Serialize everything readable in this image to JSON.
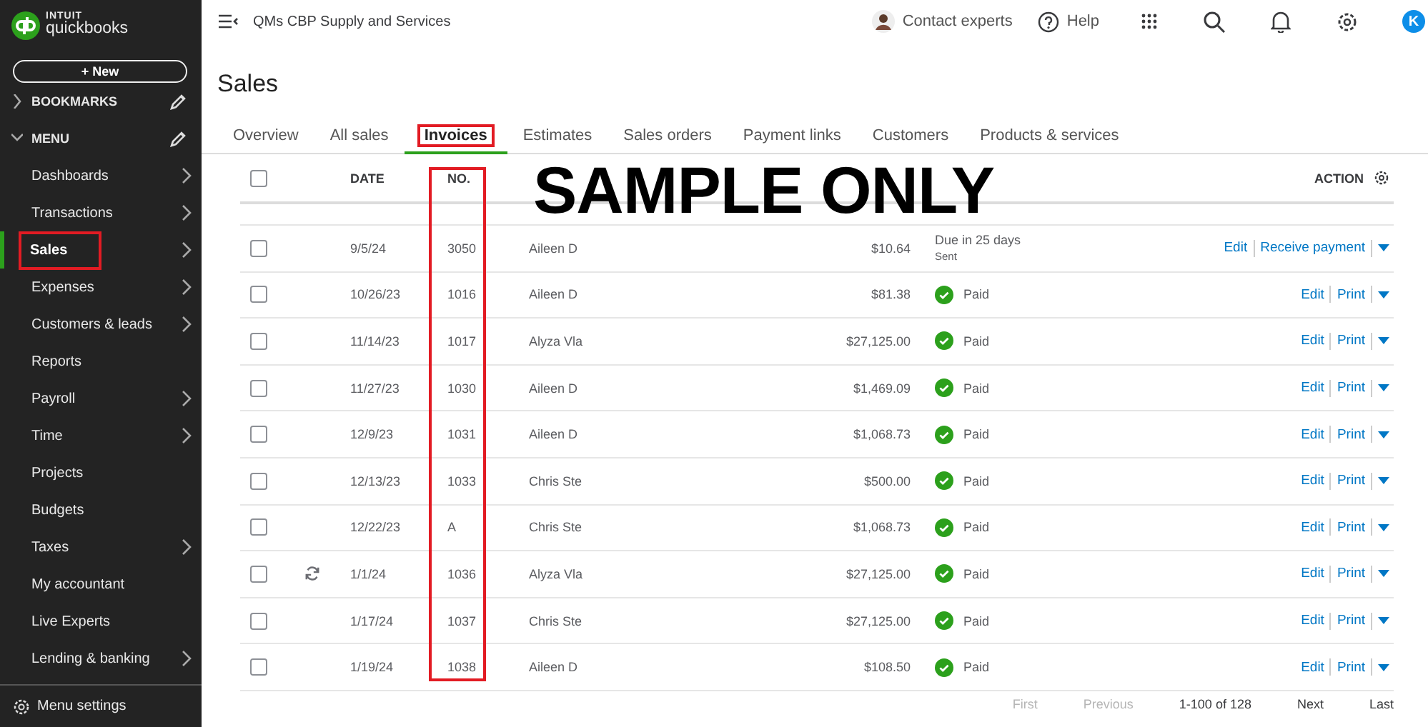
{
  "sidebar": {
    "logo": {
      "brand": "INTUIT",
      "product": "quickbooks"
    },
    "new_button": "+ New",
    "sections": [
      {
        "label": "BOOKMARKS",
        "expanded": false
      },
      {
        "label": "MENU",
        "expanded": true
      }
    ],
    "items": [
      {
        "label": "Dashboards",
        "chevron": true,
        "selected": false,
        "highlighted": false
      },
      {
        "label": "Transactions",
        "chevron": true,
        "selected": false,
        "highlighted": false
      },
      {
        "label": "Sales",
        "chevron": true,
        "selected": true,
        "highlighted": true
      },
      {
        "label": "Expenses",
        "chevron": true,
        "selected": false,
        "highlighted": false
      },
      {
        "label": "Customers & leads",
        "chevron": true,
        "selected": false,
        "highlighted": false
      },
      {
        "label": "Reports",
        "chevron": false,
        "selected": false,
        "highlighted": false
      },
      {
        "label": "Payroll",
        "chevron": true,
        "selected": false,
        "highlighted": false
      },
      {
        "label": "Time",
        "chevron": true,
        "selected": false,
        "highlighted": false
      },
      {
        "label": "Projects",
        "chevron": false,
        "selected": false,
        "highlighted": false
      },
      {
        "label": "Budgets",
        "chevron": false,
        "selected": false,
        "highlighted": false
      },
      {
        "label": "Taxes",
        "chevron": true,
        "selected": false,
        "highlighted": false
      },
      {
        "label": "My accountant",
        "chevron": false,
        "selected": false,
        "highlighted": false
      },
      {
        "label": "Live Experts",
        "chevron": false,
        "selected": false,
        "highlighted": false
      },
      {
        "label": "Lending & banking",
        "chevron": true,
        "selected": false,
        "highlighted": false
      }
    ],
    "settings": "Menu settings"
  },
  "topbar": {
    "company": "QMs CBP Supply and Services",
    "contact": "Contact experts",
    "help": "Help",
    "avatar": "K"
  },
  "page_title": "Sales",
  "tabs": [
    {
      "label": "Overview",
      "selected": false,
      "highlighted": false
    },
    {
      "label": "All sales",
      "selected": false,
      "highlighted": false
    },
    {
      "label": "Invoices",
      "selected": true,
      "highlighted": true
    },
    {
      "label": "Estimates",
      "selected": false,
      "highlighted": false
    },
    {
      "label": "Sales orders",
      "selected": false,
      "highlighted": false
    },
    {
      "label": "Payment links",
      "selected": false,
      "highlighted": false
    },
    {
      "label": "Customers",
      "selected": false,
      "highlighted": false
    },
    {
      "label": "Products & services",
      "selected": false,
      "highlighted": false
    }
  ],
  "table": {
    "header_checked": false,
    "columns": {
      "date": "DATE",
      "no": "NO.",
      "action": "ACTION"
    },
    "no_highlighted": true,
    "rows": [
      {
        "checked": false,
        "recurring": false,
        "date": "9/5/24",
        "no": "3050",
        "customer": "Aileen D",
        "amount": "$10.64",
        "kind": "due",
        "status_text": "Due in 25 days",
        "status_sub": "Sent",
        "actions": [
          "Edit",
          "Receive payment"
        ]
      },
      {
        "checked": false,
        "recurring": false,
        "date": "10/26/23",
        "no": "1016",
        "customer": "Aileen D",
        "amount": "$81.38",
        "kind": "paid",
        "status_text": "Paid",
        "actions": [
          "Edit",
          "Print"
        ]
      },
      {
        "checked": false,
        "recurring": false,
        "date": "11/14/23",
        "no": "1017",
        "customer": "Alyza Vla",
        "amount": "$27,125.00",
        "kind": "paid",
        "status_text": "Paid",
        "actions": [
          "Edit",
          "Print"
        ]
      },
      {
        "checked": false,
        "recurring": false,
        "date": "11/27/23",
        "no": "1030",
        "customer": "Aileen D",
        "amount": "$1,469.09",
        "kind": "paid",
        "status_text": "Paid",
        "actions": [
          "Edit",
          "Print"
        ]
      },
      {
        "checked": false,
        "recurring": false,
        "date": "12/9/23",
        "no": "1031",
        "customer": "Aileen D",
        "amount": "$1,068.73",
        "kind": "paid",
        "status_text": "Paid",
        "actions": [
          "Edit",
          "Print"
        ]
      },
      {
        "checked": false,
        "recurring": false,
        "date": "12/13/23",
        "no": "1033",
        "customer": "Chris Ste",
        "amount": "$500.00",
        "kind": "paid",
        "status_text": "Paid",
        "actions": [
          "Edit",
          "Print"
        ]
      },
      {
        "checked": false,
        "recurring": false,
        "date": "12/22/23",
        "no": "A",
        "customer": "Chris Ste",
        "amount": "$1,068.73",
        "kind": "paid",
        "status_text": "Paid",
        "actions": [
          "Edit",
          "Print"
        ]
      },
      {
        "checked": false,
        "recurring": true,
        "date": "1/1/24",
        "no": "1036",
        "customer": "Alyza Vla",
        "amount": "$27,125.00",
        "kind": "paid",
        "status_text": "Paid",
        "actions": [
          "Edit",
          "Print"
        ]
      },
      {
        "checked": false,
        "recurring": false,
        "date": "1/17/24",
        "no": "1037",
        "customer": "Chris Ste",
        "amount": "$27,125.00",
        "kind": "paid",
        "status_text": "Paid",
        "actions": [
          "Edit",
          "Print"
        ]
      },
      {
        "checked": false,
        "recurring": false,
        "date": "1/19/24",
        "no": "1038",
        "customer": "Aileen D",
        "amount": "$108.50",
        "kind": "paid",
        "status_text": "Paid",
        "actions": [
          "Edit",
          "Print"
        ]
      }
    ]
  },
  "pagination": {
    "first": {
      "label": "First",
      "disabled": true
    },
    "previous": {
      "label": "Previous",
      "disabled": true
    },
    "range": "1-100 of 128",
    "next": {
      "label": "Next",
      "disabled": false
    },
    "last": {
      "label": "Last",
      "disabled": false
    }
  },
  "overlay_text": "SAMPLE ONLY"
}
